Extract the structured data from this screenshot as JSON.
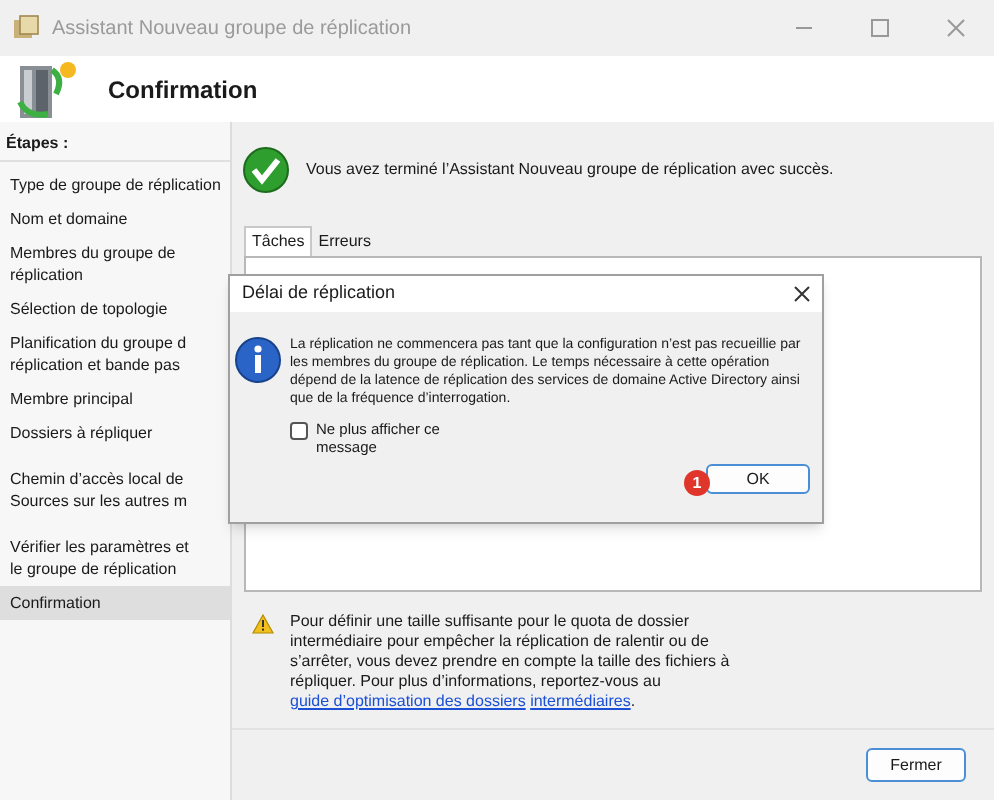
{
  "window": {
    "title": "Assistant Nouveau groupe de réplication"
  },
  "header": {
    "title": "Confirmation"
  },
  "sidebar": {
    "heading": "Étapes :",
    "items": [
      {
        "lines": [
          "Type de groupe de réplication"
        ],
        "selected": false
      },
      {
        "lines": [
          "Nom et domaine"
        ],
        "selected": false
      },
      {
        "lines": [
          "Membres du groupe de",
          "réplication"
        ],
        "selected": false
      },
      {
        "lines": [
          "Sélection de topologie"
        ],
        "selected": false
      },
      {
        "lines": [
          "Planification du groupe d",
          "réplication et bande pas"
        ],
        "selected": false
      },
      {
        "lines": [
          "Membre principal"
        ],
        "selected": false
      },
      {
        "lines": [
          "Dossiers à répliquer"
        ],
        "selected": false
      },
      {
        "lines": [
          "Chemin d’accès local de",
          "Sources sur les autres m"
        ],
        "selected": false
      },
      {
        "lines": [
          "Vérifier les paramètres et",
          "le groupe de réplication"
        ],
        "selected": false
      },
      {
        "lines": [
          "Confirmation"
        ],
        "selected": true
      }
    ]
  },
  "main": {
    "success": "Vous avez terminé l’Assistant Nouveau groupe de réplication avec succès.",
    "tabs": [
      {
        "label": "Tâches",
        "selected": true
      },
      {
        "label": "Erreurs",
        "selected": false
      }
    ],
    "warning": {
      "text": "Pour définir une taille suffisante pour le quota de dossier intermédiaire pour empêcher la réplication de ralentir ou de s’arrêter, vous devez prendre en compte la taille des fichiers à répliquer. Pour plus d’informations, reportez-vous au ",
      "link": "guide d’optimisation des dossiers",
      "link2": "intermédiaires",
      "end": "."
    }
  },
  "dialog": {
    "title": "Délai de réplication",
    "message": "La réplication ne commencera pas tant que la configuration n’est pas recueillie par les membres du groupe de réplication. Le temps nécessaire à cette opération dépend de la latence de réplication des services de domaine Active Directory ainsi que de la fréquence d’interrogation.",
    "checkbox": {
      "label": "Ne plus afficher ce message",
      "checked": false
    },
    "ok": "OK",
    "badge": "1"
  },
  "buttons": [
    {
      "label": "Fermer"
    }
  ]
}
